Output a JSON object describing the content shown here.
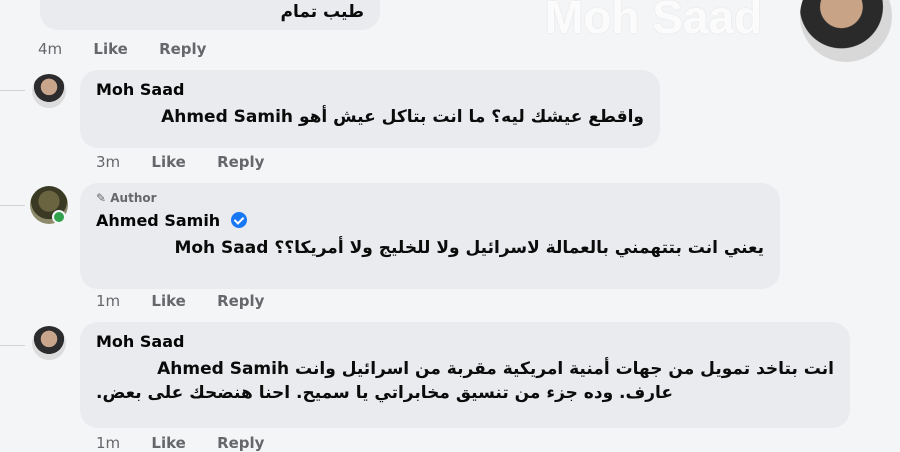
{
  "watermark_name": "Moh Saad",
  "top_comment": {
    "text": "طيب تمام",
    "time": "4m",
    "like": "Like",
    "reply": "Reply"
  },
  "comments": [
    {
      "name": "Moh Saad",
      "text": "Ahmed Samih واقطع عيشك ليه؟ ما انت بتاكل عيش أهو",
      "time": "3m",
      "like": "Like",
      "reply": "Reply"
    },
    {
      "name": "Ahmed Samih",
      "author_label": "Author",
      "text": "Moh Saad يعني انت بتتهمني بالعمالة لاسرائيل ولا للخليج ولا أمريكا؟؟",
      "time": "1m",
      "like": "Like",
      "reply": "Reply"
    },
    {
      "name": "Moh Saad",
      "text_line1": "Ahmed Samih انت بتاخد تمويل من جهات أمنية امريكية مقربة من اسرائيل وانت",
      "text_line2": "عارف. وده جزء من تنسيق مخابراتي يا سميح. احنا هنضحك على بعض.",
      "time": "1m",
      "like": "Like",
      "reply": "Reply"
    }
  ]
}
